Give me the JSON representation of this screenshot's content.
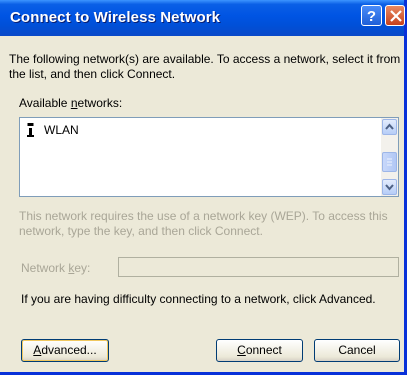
{
  "window": {
    "title": "Connect to Wireless Network",
    "help_glyph": "?"
  },
  "intro_text": "The following network(s) are available. To access a network, select it from the list, and then click Connect.",
  "available_networks": {
    "label_pre": "Available ",
    "label_accel": "n",
    "label_post": "etworks:",
    "items": [
      {
        "name": "WLAN",
        "icon": "wireless-network-icon"
      }
    ]
  },
  "wep_text": "This network requires the use of a network key (WEP). To access this network, type the key, and then click Connect.",
  "network_key": {
    "label_pre": "Network ",
    "label_accel": "k",
    "label_post": "ey:",
    "value": "",
    "enabled": false
  },
  "advanced_help": "If you are having difficulty connecting to a network, click Advanced.",
  "buttons": {
    "advanced_accel": "A",
    "advanced_rest": "dvanced...",
    "connect_accel": "C",
    "connect_rest": "onnect",
    "cancel": "Cancel"
  },
  "colors": {
    "titlebar": "#0054e3",
    "dialog_bg": "#ece9d8",
    "disabled_text": "#a9a697",
    "close_button": "#c7401c"
  }
}
